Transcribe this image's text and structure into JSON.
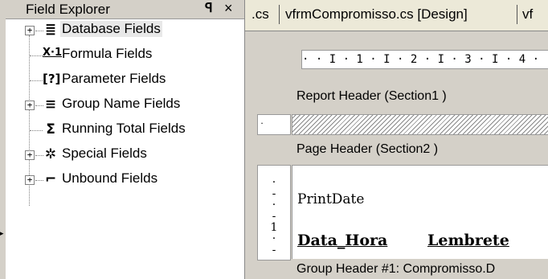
{
  "field_explorer": {
    "title": "Field Explorer",
    "pin_glyph": "ᵖ",
    "close_glyph": "×",
    "items": [
      {
        "label": "Database Fields",
        "icon": "database-icon",
        "glyph": "≣",
        "expandable": true,
        "selected": true
      },
      {
        "label": "Formula Fields",
        "icon": "formula-icon",
        "glyph": "X·1",
        "expandable": false
      },
      {
        "label": "Parameter Fields",
        "icon": "parameter-icon",
        "glyph": "[?]",
        "expandable": false
      },
      {
        "label": "Group Name Fields",
        "icon": "group-name-icon",
        "glyph": "≡",
        "expandable": true
      },
      {
        "label": "Running Total Fields",
        "icon": "running-total-icon",
        "glyph": "Σ",
        "expandable": false
      },
      {
        "label": "Special Fields",
        "icon": "special-fields-icon",
        "glyph": "✲",
        "expandable": true
      },
      {
        "label": "Unbound Fields",
        "icon": "unbound-fields-icon",
        "glyph": "⌐",
        "expandable": true
      }
    ]
  },
  "designer": {
    "tabs": [
      ".cs",
      "vfrmCompromisso.cs [Design]",
      "vf"
    ],
    "ruler_text": "· · I · 1 · I · 2 · I · 3 · I · 4 ·",
    "sections": {
      "report_header": "Report Header  (Section1 )",
      "page_header": "Page Header  (Section2 )",
      "group_header": "Group Header #1: Compromisso.D"
    },
    "fields": {
      "print_date": "PrintDate",
      "data_hora": "Data_Hora",
      "lembrete": "Lembrete"
    }
  }
}
